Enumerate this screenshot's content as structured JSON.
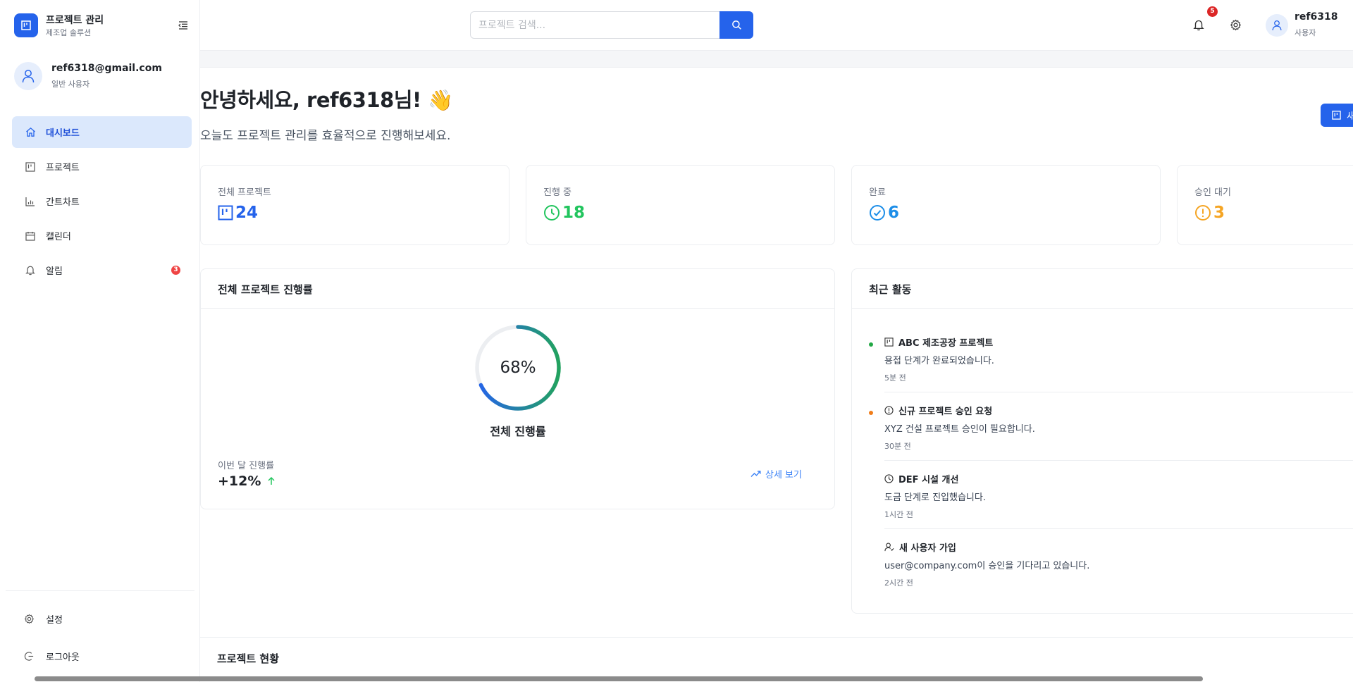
{
  "brand": {
    "title": "프로젝트 관리",
    "subtitle": "제조업 솔루션"
  },
  "user": {
    "email": "ref6318@gmail.com",
    "role": "일반 사용자"
  },
  "nav": [
    {
      "label": "대시보드",
      "icon": "home-icon",
      "active": true
    },
    {
      "label": "프로젝트",
      "icon": "project-icon"
    },
    {
      "label": "간트차트",
      "icon": "bar-chart-icon"
    },
    {
      "label": "캘린더",
      "icon": "calendar-icon"
    },
    {
      "label": "알림",
      "icon": "bell-icon",
      "badge": "3"
    }
  ],
  "sidebar_bottom": {
    "settings": "설정",
    "logout": "로그아웃"
  },
  "header": {
    "search_placeholder": "프로젝트 검색...",
    "notification_count": "5",
    "username": "ref6318",
    "userrole": "사용자"
  },
  "main": {
    "greeting": "안녕하세요, ref6318님! 👋",
    "subtitle": "오늘도 프로젝트 관리를 효율적으로 진행해보세요.",
    "new_button": "새"
  },
  "stats": [
    {
      "label": "전체 프로젝트",
      "value": "24",
      "color": "#2563eb",
      "icon": "project-icon"
    },
    {
      "label": "진행 중",
      "value": "18",
      "color": "#22c55e",
      "icon": "clock-icon"
    },
    {
      "label": "완료",
      "value": "6",
      "color": "#1d8ee8",
      "icon": "check-circle-icon"
    },
    {
      "label": "승인 대기",
      "value": "3",
      "color": "#f5a524",
      "icon": "alert-circle-icon"
    }
  ],
  "progress": {
    "title": "전체 프로젝트 진행률",
    "percent": 68,
    "percent_text": "68%",
    "label": "전체 진행률",
    "month_label": "이번 달 진행률",
    "month_value": "+12%",
    "detail_link": "상세 보기"
  },
  "activity": {
    "title": "최근 활동",
    "items": [
      {
        "title": "ABC 제조공장 프로젝트",
        "desc": "용접 단계가 완료되었습니다.",
        "time": "5분 전",
        "dot": "#22a845",
        "icon": "project-icon"
      },
      {
        "title": "신규 프로젝트 승인 요청",
        "desc": "XYZ 건설 프로젝트 승인이 필요합니다.",
        "time": "30분 전",
        "dot": "#f07d1a",
        "icon": "alert-circle-icon"
      },
      {
        "title": "DEF 시설 개선",
        "desc": "도금 단계로 진입했습니다.",
        "time": "1시간 전",
        "dot": "",
        "icon": "clock-icon"
      },
      {
        "title": "새 사용자 가입",
        "desc": "user@company.com이 승인을 기다리고 있습니다.",
        "time": "2시간 전",
        "dot": "",
        "icon": "user-add-icon"
      }
    ]
  },
  "section": {
    "title": "프로젝트 현황"
  }
}
